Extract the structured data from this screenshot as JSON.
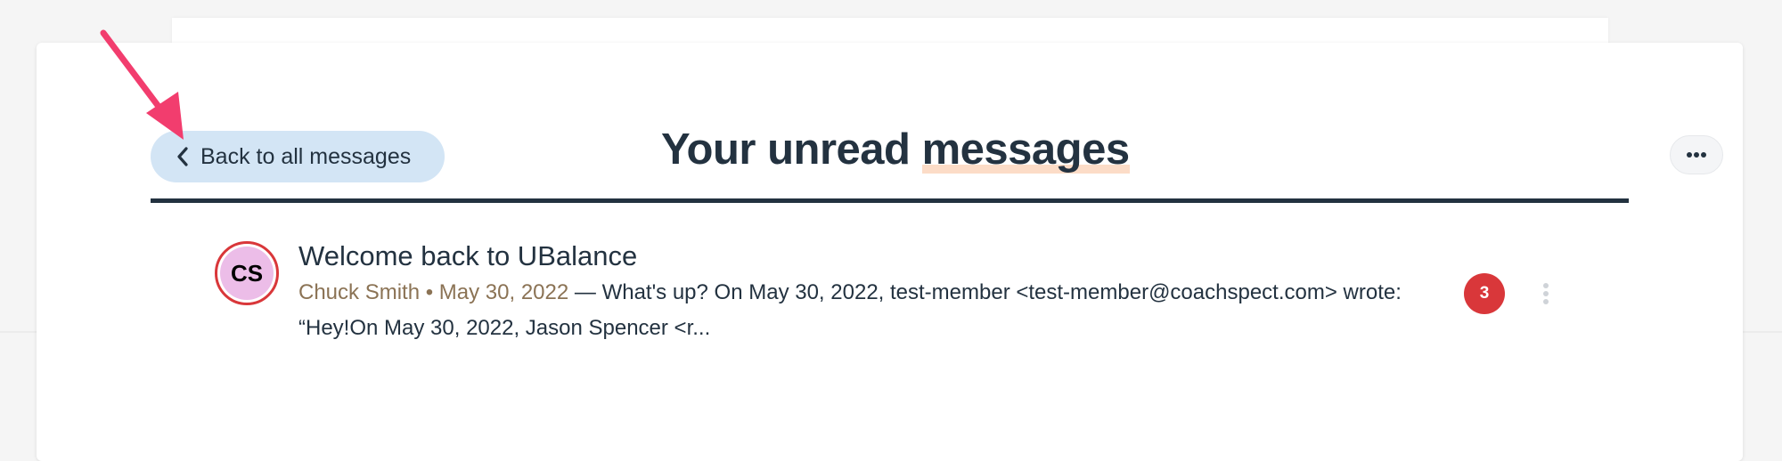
{
  "back_button": {
    "label": "Back to all messages",
    "icon": "chevron-left-icon"
  },
  "page_title": {
    "before": "Your unread ",
    "emphasis": "messages"
  },
  "more_button": {
    "icon": "more-horizontal-icon"
  },
  "message": {
    "avatar_initials": "CS",
    "subject": "Welcome back to UBalance",
    "sender": "Chuck Smith",
    "separator": " • ",
    "date": "May 30, 2022",
    "preview_line1": " — What's up? On May 30, 2022, test-member <test-member@coachspect.com> wrote:",
    "preview_line2": "“Hey!On May 30, 2022, Jason Spencer <r...",
    "unread_count": "3",
    "menu_icon": "more-vertical-icon"
  },
  "annotation": {
    "icon": "pointer-arrow-icon",
    "color": "#f23d6e"
  },
  "colors": {
    "primary_text": "#233240",
    "back_button_bg": "#d3e5f5",
    "badge": "#d9373a",
    "avatar_bg": "#ecbde8",
    "meta_text": "#8b7355",
    "title_highlight": "#fcdcc7"
  }
}
